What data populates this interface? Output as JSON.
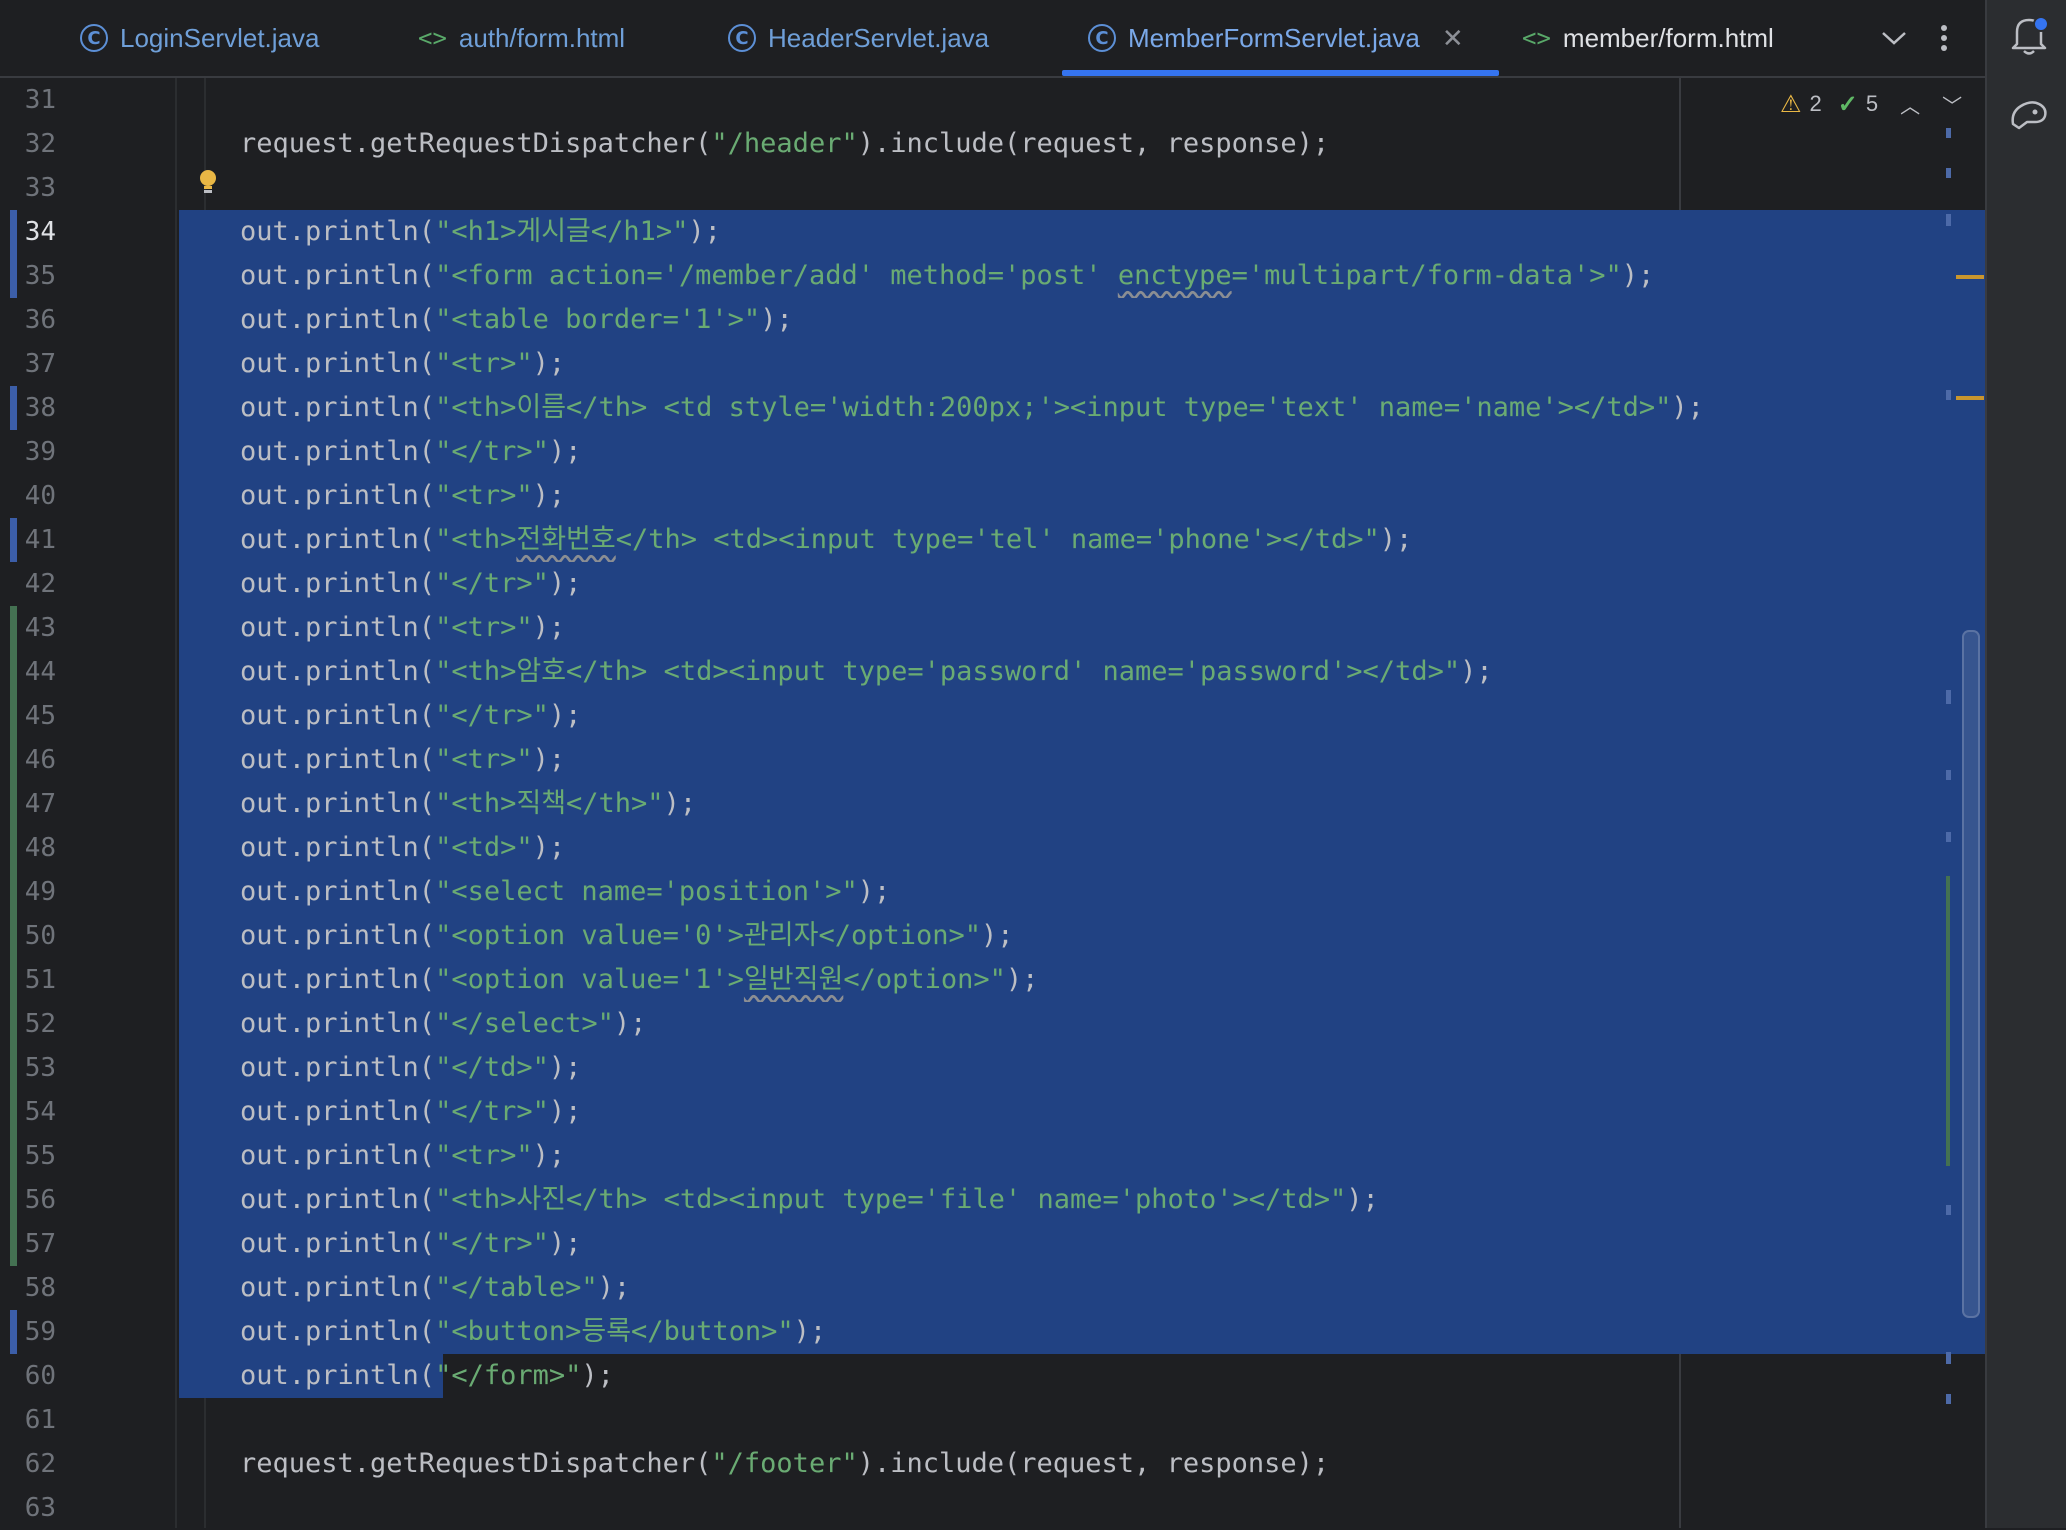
{
  "tabs": [
    {
      "label": "LoginServlet.java",
      "kind": "java"
    },
    {
      "label": "auth/form.html",
      "kind": "html"
    },
    {
      "label": "HeaderServlet.java",
      "kind": "java"
    },
    {
      "label": "MemberFormServlet.java",
      "kind": "java",
      "active": true
    },
    {
      "label": "member/form.html",
      "kind": "html"
    }
  ],
  "inspections": {
    "warnings": "2",
    "ok": "5"
  },
  "editor": {
    "current_line": "34",
    "lines": [
      {
        "n": "31",
        "code": ""
      },
      {
        "n": "32",
        "code": "request.getRequestDispatcher(\"/header\").include(request, response);"
      },
      {
        "n": "33",
        "code": ""
      },
      {
        "n": "34",
        "code": "out.println(\"<h1>게시글</h1>\");"
      },
      {
        "n": "35",
        "code": "out.println(\"<form action='/member/add' method='post' enctype='multipart/form-data'>\");"
      },
      {
        "n": "36",
        "code": "out.println(\"<table border='1'>\");"
      },
      {
        "n": "37",
        "code": "out.println(\"<tr>\");"
      },
      {
        "n": "38",
        "code": "out.println(\"<th>이름</th> <td style='width:200px;'><input type='text' name='name'></td>\");"
      },
      {
        "n": "39",
        "code": "out.println(\"</tr>\");"
      },
      {
        "n": "40",
        "code": "out.println(\"<tr>\");"
      },
      {
        "n": "41",
        "code": "out.println(\"<th>전화번호</th> <td><input type='tel' name='phone'></td>\");"
      },
      {
        "n": "42",
        "code": "out.println(\"</tr>\");"
      },
      {
        "n": "43",
        "code": "out.println(\"<tr>\");"
      },
      {
        "n": "44",
        "code": "out.println(\"<th>암호</th> <td><input type='password' name='password'></td>\");"
      },
      {
        "n": "45",
        "code": "out.println(\"</tr>\");"
      },
      {
        "n": "46",
        "code": "out.println(\"<tr>\");"
      },
      {
        "n": "47",
        "code": "out.println(\"<th>직책</th>\");"
      },
      {
        "n": "48",
        "code": "out.println(\"<td>\");"
      },
      {
        "n": "49",
        "code": "out.println(\"<select name='position'>\");"
      },
      {
        "n": "50",
        "code": "out.println(\"<option value='0'>관리자</option>\");"
      },
      {
        "n": "51",
        "code": "out.println(\"<option value='1'>일반직원</option>\");"
      },
      {
        "n": "52",
        "code": "out.println(\"</select>\");"
      },
      {
        "n": "53",
        "code": "out.println(\"</td>\");"
      },
      {
        "n": "54",
        "code": "out.println(\"</tr>\");"
      },
      {
        "n": "55",
        "code": "out.println(\"<tr>\");"
      },
      {
        "n": "56",
        "code": "out.println(\"<th>사진</th> <td><input type='file' name='photo'></td>\");"
      },
      {
        "n": "57",
        "code": "out.println(\"</tr>\");"
      },
      {
        "n": "58",
        "code": "out.println(\"</table>\");"
      },
      {
        "n": "59",
        "code": "out.println(\"<button>등록</button>\");"
      },
      {
        "n": "60",
        "code": "out.println(\"</form>\");"
      },
      {
        "n": "61",
        "code": ""
      },
      {
        "n": "62",
        "code": "request.getRequestDispatcher(\"/footer\").include(request, response);"
      },
      {
        "n": "63",
        "code": ""
      }
    ]
  },
  "icons": {
    "java_tab": "class-icon",
    "html_tab": "html-file-icon",
    "close": "close-icon",
    "tab_list": "chevron-down-icon",
    "more": "more-vertical-icon",
    "notifications": "bell-icon",
    "ai_assistant": "ai-assistant-icon",
    "intention": "lightbulb-icon",
    "warning": "warning-icon",
    "check": "check-icon"
  },
  "colors": {
    "background": "#1e1f22",
    "selection": "#214283",
    "string": "#6aab73",
    "text": "#bcbec4",
    "accent": "#3574f0",
    "vcs_modified": "#3c5ea8",
    "vcs_added": "#447152"
  }
}
